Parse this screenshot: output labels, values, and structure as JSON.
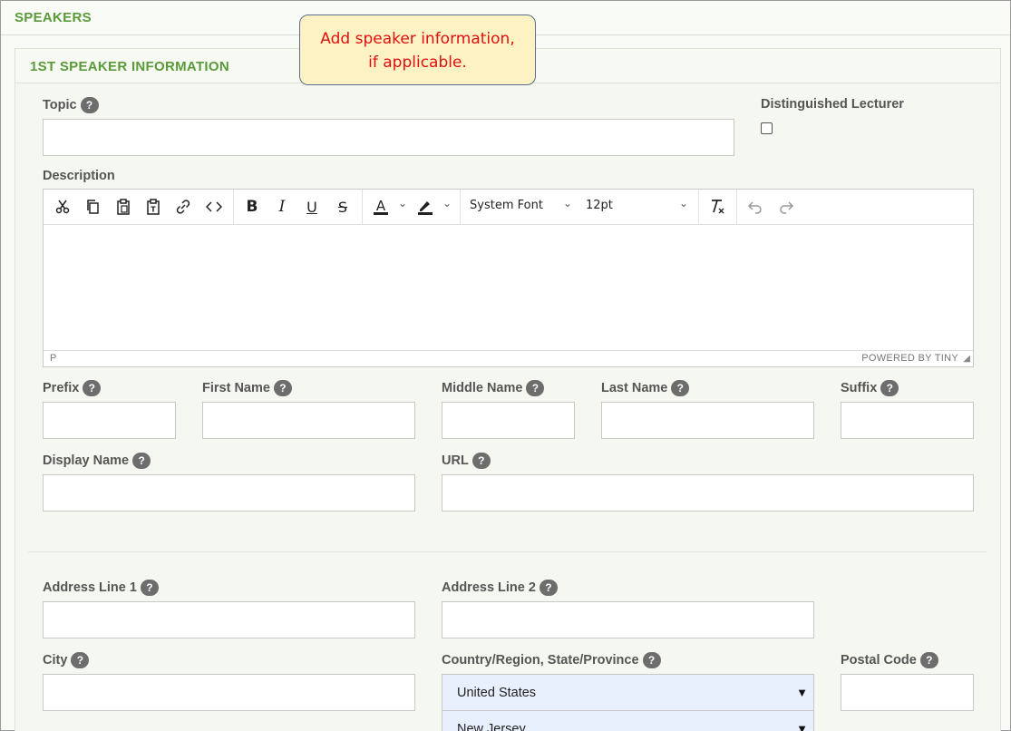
{
  "header": {
    "title": "SPEAKERS"
  },
  "panel": {
    "title": "1ST SPEAKER INFORMATION"
  },
  "callout": {
    "line1": "Add speaker information,",
    "line2": "if applicable."
  },
  "fields": {
    "topic": {
      "label": "Topic",
      "value": ""
    },
    "distinguished": {
      "label": "Distinguished Lecturer",
      "checked": false
    },
    "description": {
      "label": "Description"
    },
    "prefix": {
      "label": "Prefix",
      "value": ""
    },
    "first_name": {
      "label": "First Name",
      "value": ""
    },
    "middle_name": {
      "label": "Middle Name",
      "value": ""
    },
    "last_name": {
      "label": "Last Name",
      "value": ""
    },
    "suffix": {
      "label": "Suffix",
      "value": ""
    },
    "display_name": {
      "label": "Display Name",
      "value": ""
    },
    "url": {
      "label": "URL",
      "value": ""
    },
    "address1": {
      "label": "Address Line 1",
      "value": ""
    },
    "address2": {
      "label": "Address Line 2",
      "value": ""
    },
    "city": {
      "label": "City",
      "value": ""
    },
    "country": {
      "label": "Country/Region, State/Province",
      "country_value": "United States",
      "state_value": "New Jersey"
    },
    "postal": {
      "label": "Postal Code",
      "value": ""
    }
  },
  "help_glyph": "?",
  "editor": {
    "font_family": "System Font",
    "font_size": "12pt",
    "status_path": "P",
    "branding": "POWERED BY TINY",
    "toolbar_icons": [
      "cut-icon",
      "copy-icon",
      "paste-icon",
      "paste-text-icon",
      "link-icon",
      "code-icon",
      "bold-icon",
      "italic-icon",
      "underline-icon",
      "strikethrough-icon",
      "text-color-icon",
      "highlight-color-icon",
      "clear-formatting-icon",
      "undo-icon",
      "redo-icon"
    ]
  }
}
